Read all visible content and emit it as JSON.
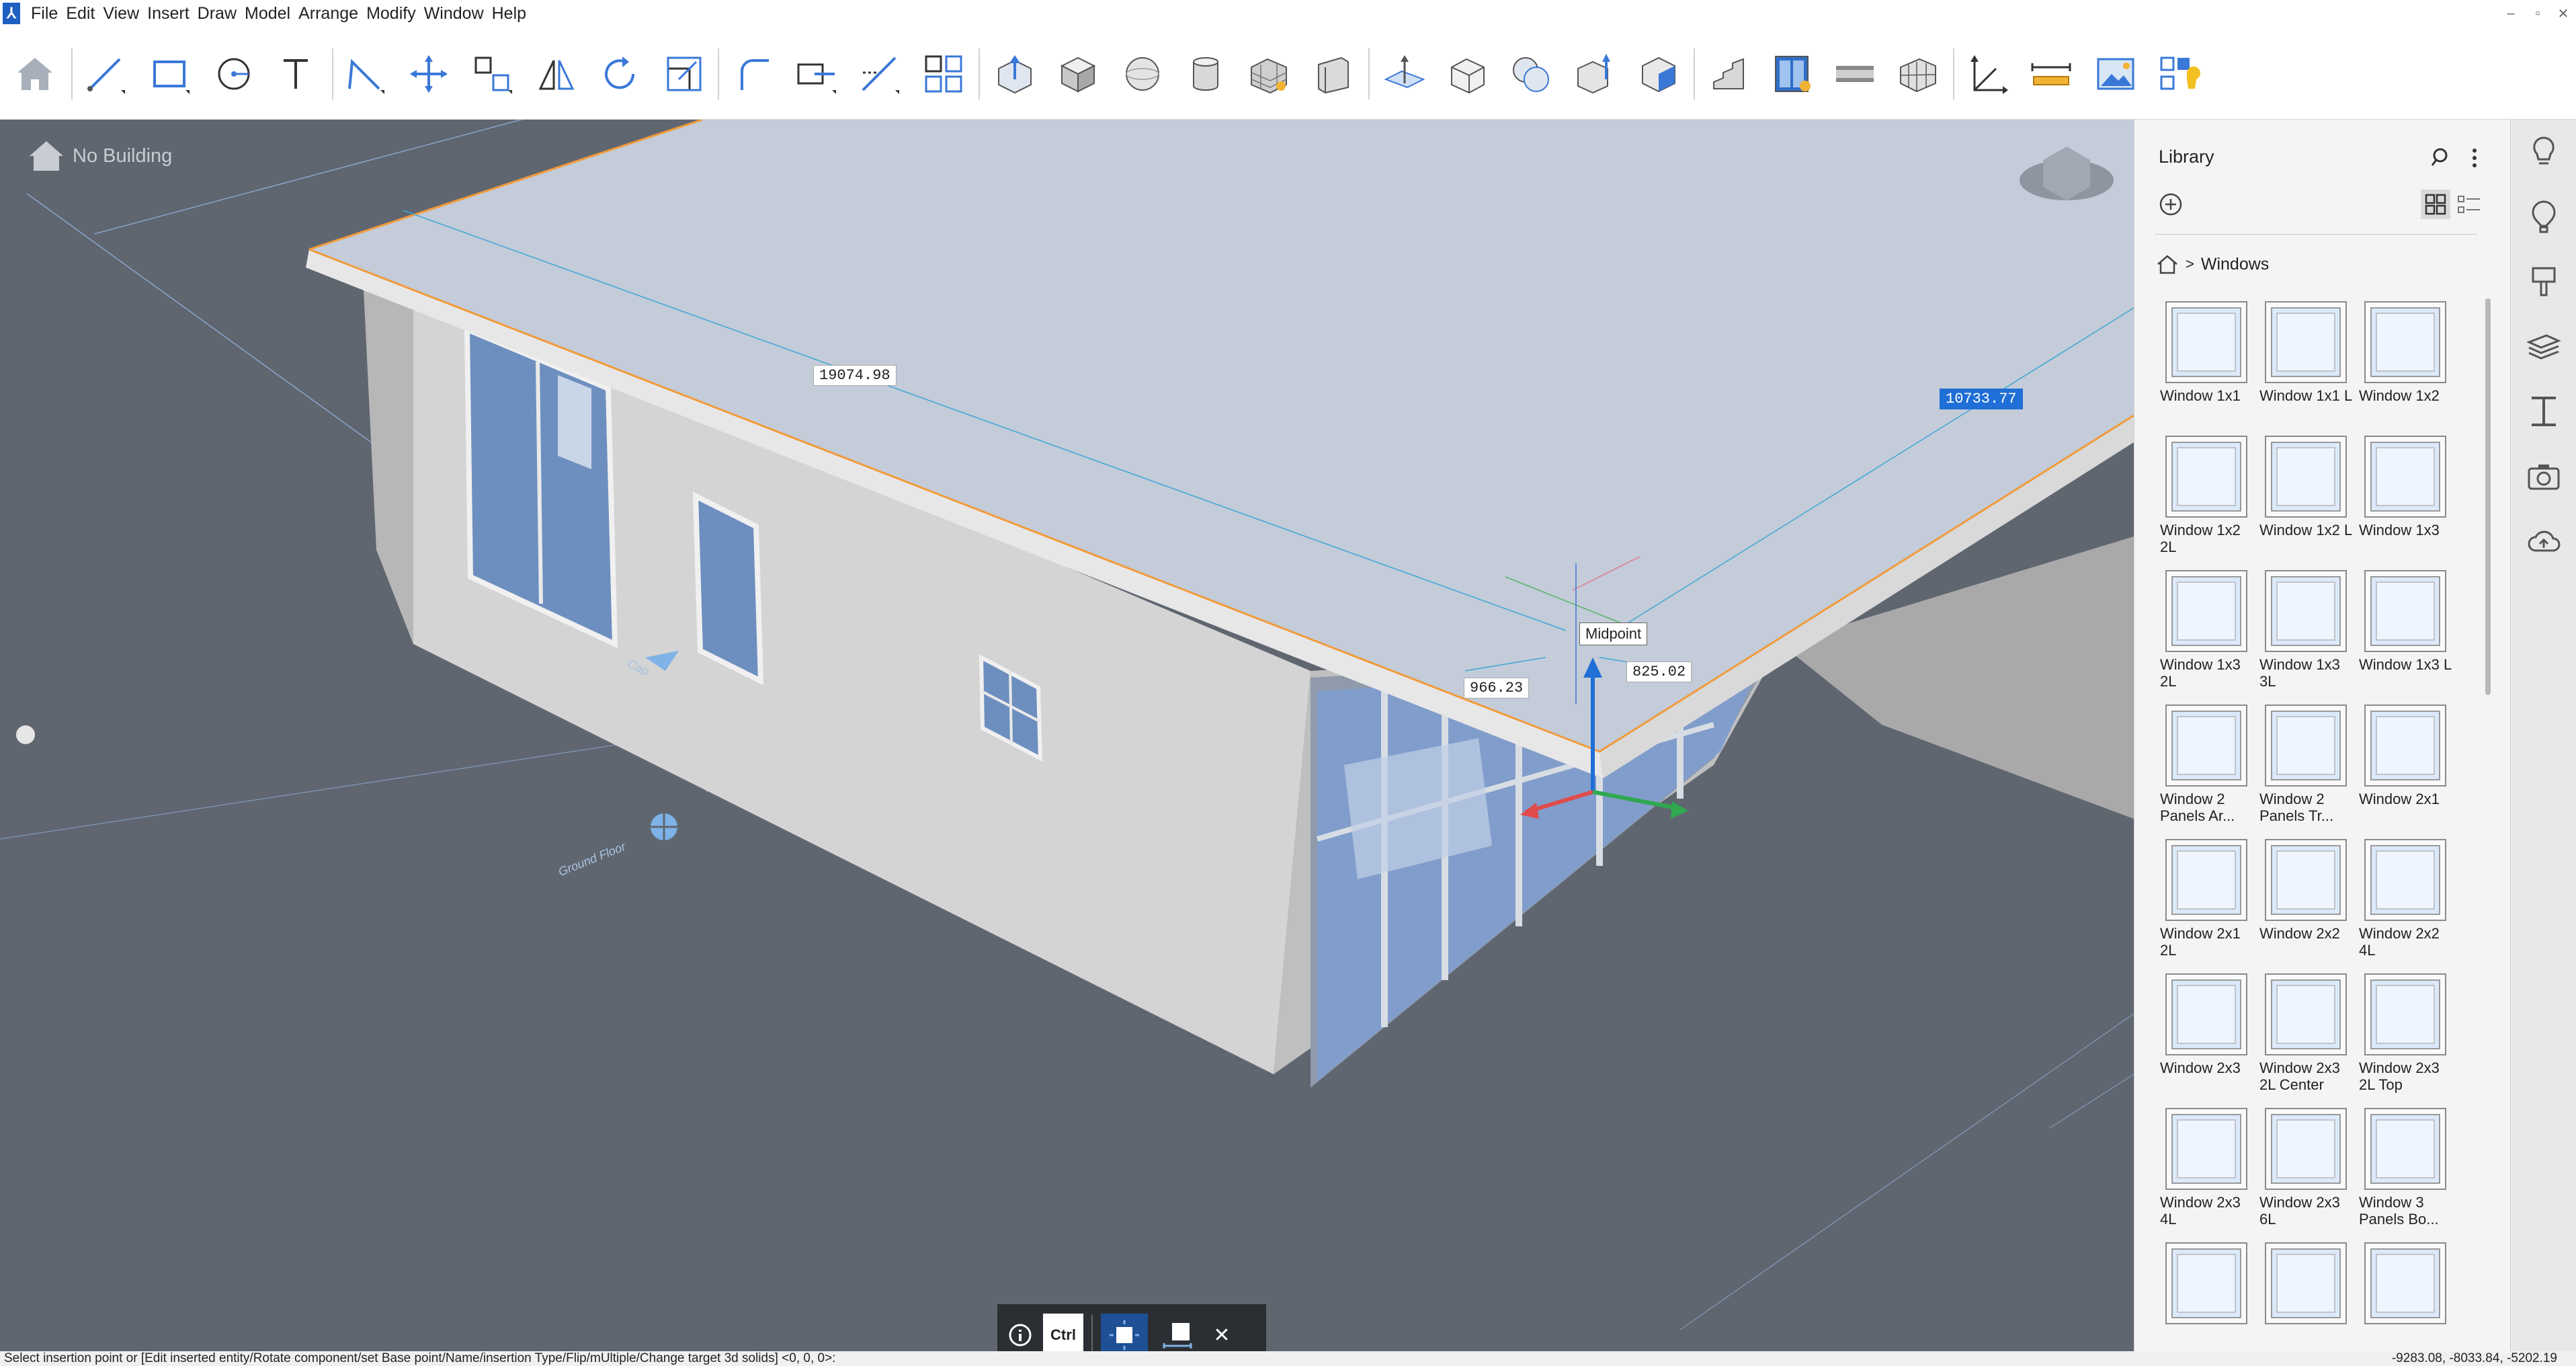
{
  "menubar": {
    "items": [
      "File",
      "Edit",
      "View",
      "Insert",
      "Draw",
      "Model",
      "Arrange",
      "Modify",
      "Window",
      "Help"
    ]
  },
  "toolbar": {
    "tools": [
      "home-icon",
      "line-icon",
      "rectangle-icon",
      "circle-icon",
      "text-icon",
      "polyline-icon",
      "move-icon",
      "copy-icon",
      "mirror-icon",
      "rotate-icon",
      "scale-icon",
      "fillet-icon",
      "stretch-icon",
      "trim-icon",
      "array-icon",
      "push-pull-icon",
      "box-icon",
      "sphere-icon",
      "cylinder-icon",
      "wall-icon",
      "slab-icon",
      "section-plane-icon",
      "shell-icon",
      "boolean-icon",
      "extrude-icon",
      "solid-icon",
      "stair-icon",
      "window-tool-icon",
      "beam-icon",
      "curtain-wall-icon",
      "dimension-icon",
      "measure-icon",
      "image-icon",
      "settings-icon"
    ]
  },
  "viewport": {
    "building_label": "No Building",
    "dim_length": "19074.98",
    "dim_width": "10733.77",
    "dim_left": "966.23",
    "dim_right": "825.02",
    "snap_tooltip": "Midpoint",
    "floor_label_top": "Cap",
    "floor_label_ground": "Ground Floor"
  },
  "library": {
    "title": "Library",
    "breadcrumb_sep": ">",
    "breadcrumb": "Windows",
    "items": [
      {
        "label": "Window 1x1"
      },
      {
        "label": "Window 1x1 L"
      },
      {
        "label": "Window 1x2"
      },
      {
        "label": "Window 1x2 2L"
      },
      {
        "label": "Window 1x2 L"
      },
      {
        "label": "Window 1x3"
      },
      {
        "label": "Window 1x3 2L"
      },
      {
        "label": "Window 1x3 3L"
      },
      {
        "label": "Window 1x3 L"
      },
      {
        "label": "Window 2 Panels Ar..."
      },
      {
        "label": "Window 2 Panels Tr..."
      },
      {
        "label": "Window 2x1"
      },
      {
        "label": "Window 2x1 2L"
      },
      {
        "label": "Window 2x2"
      },
      {
        "label": "Window 2x2 4L"
      },
      {
        "label": "Window 2x3"
      },
      {
        "label": "Window 2x3 2L Center"
      },
      {
        "label": "Window 2x3 2L Top"
      },
      {
        "label": "Window 2x3 4L"
      },
      {
        "label": "Window 2x3 6L"
      },
      {
        "label": "Window 3 Panels Bo..."
      },
      {
        "label": ""
      },
      {
        "label": ""
      },
      {
        "label": ""
      }
    ]
  },
  "cmdpopup": {
    "ctrl_label": "Ctrl",
    "close": "✕"
  },
  "statusbar": {
    "prompt": "Select insertion point or [Edit inserted entity/Rotate component/set Base point/Name/insertion Type/Flip/mUltiple/Change target 3d solids] <0, 0, 0>:",
    "coords": "-9283.08, -8033.84, -5202.19"
  },
  "colors": {
    "accent": "#1f6fd6",
    "roof": "#c3ccd8",
    "wall": "#d4d4d4",
    "ground": "#5f6670",
    "edge_highlight": "#f29a3a"
  }
}
